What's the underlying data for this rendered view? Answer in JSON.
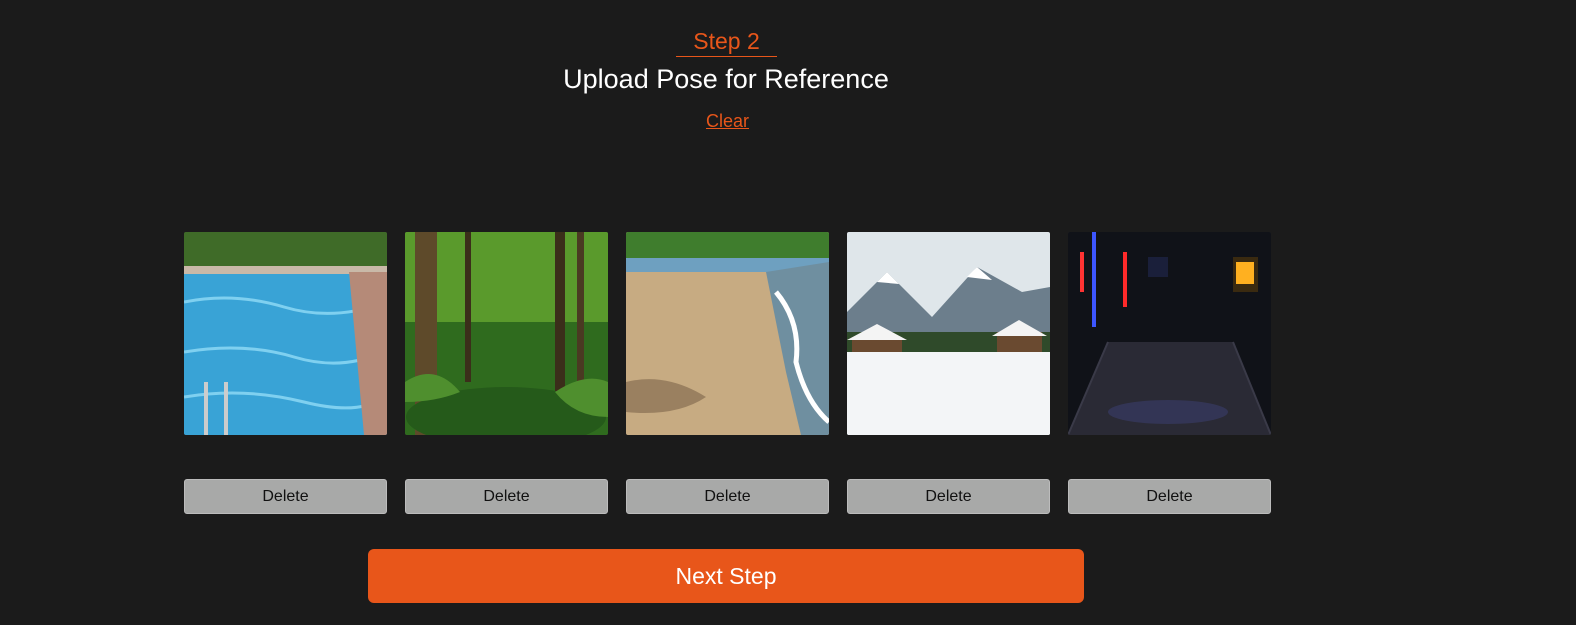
{
  "header": {
    "step_label": "Step 2",
    "title": "Upload Pose for Reference",
    "clear_label": "Clear"
  },
  "gallery": {
    "items": [
      {
        "scene": "pool-image",
        "delete_label": "Delete"
      },
      {
        "scene": "forest-image",
        "delete_label": "Delete"
      },
      {
        "scene": "beach-image",
        "delete_label": "Delete"
      },
      {
        "scene": "snow-mountain-image",
        "delete_label": "Delete"
      },
      {
        "scene": "neon-club-image",
        "delete_label": "Delete"
      }
    ]
  },
  "footer": {
    "next_label": "Next Step"
  },
  "colors": {
    "accent": "#e8561a",
    "background": "#1b1b1b",
    "delete_button": "#a8a9a8"
  }
}
